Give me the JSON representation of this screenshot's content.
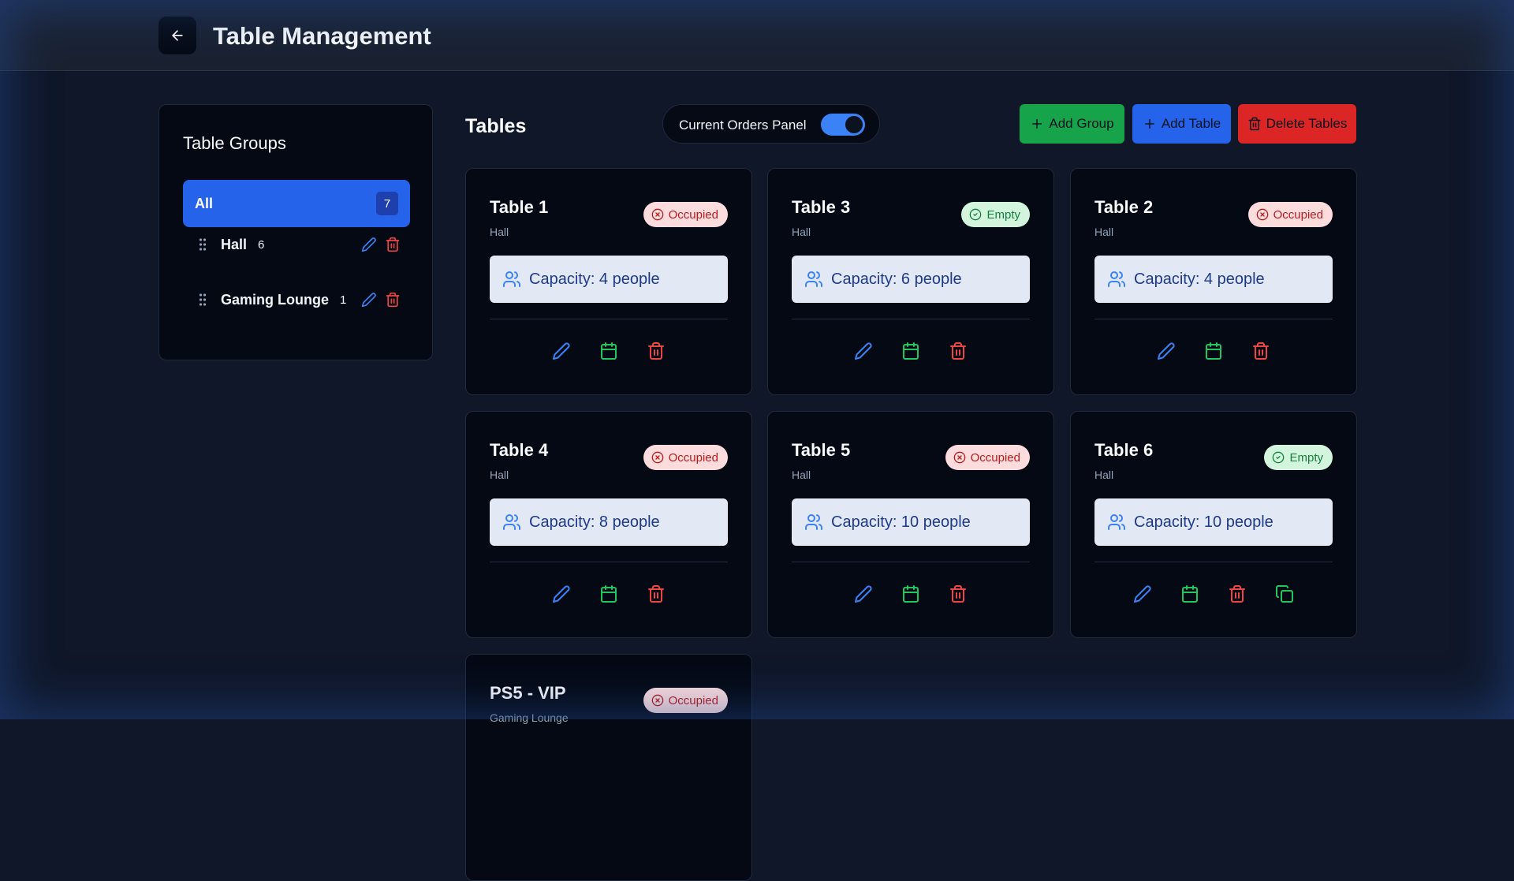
{
  "header": {
    "title": "Table Management"
  },
  "groups": {
    "title": "Table Groups",
    "all": {
      "label": "All",
      "count": "7"
    },
    "items": [
      {
        "name": "Hall",
        "count": "6"
      },
      {
        "name": "Gaming Lounge",
        "count": "1"
      }
    ]
  },
  "tables_section": {
    "title": "Tables",
    "orders_toggle_label": "Current Orders Panel",
    "orders_toggle_on": true,
    "add_group_label": "Add Group",
    "add_table_label": "Add Table",
    "delete_tables_label": "Delete Tables"
  },
  "cards": [
    {
      "title": "Table 1",
      "group": "Hall",
      "status": "Occupied",
      "capacity": "Capacity: 4 people"
    },
    {
      "title": "Table 3",
      "group": "Hall",
      "status": "Empty",
      "capacity": "Capacity: 6 people"
    },
    {
      "title": "Table 2",
      "group": "Hall",
      "status": "Occupied",
      "capacity": "Capacity: 4 people"
    },
    {
      "title": "Table 4",
      "group": "Hall",
      "status": "Occupied",
      "capacity": "Capacity: 8 people"
    },
    {
      "title": "Table 5",
      "group": "Hall",
      "status": "Occupied",
      "capacity": "Capacity: 10 people"
    },
    {
      "title": "Table 6",
      "group": "Hall",
      "status": "Empty",
      "capacity": "Capacity: 10 people"
    },
    {
      "title": "PS5 - VIP",
      "group": "Gaming Lounge",
      "status": "Occupied",
      "capacity": ""
    }
  ],
  "colors": {
    "accent_blue": "#2563eb",
    "success_green": "#16a34a",
    "danger_red": "#dc2626"
  }
}
